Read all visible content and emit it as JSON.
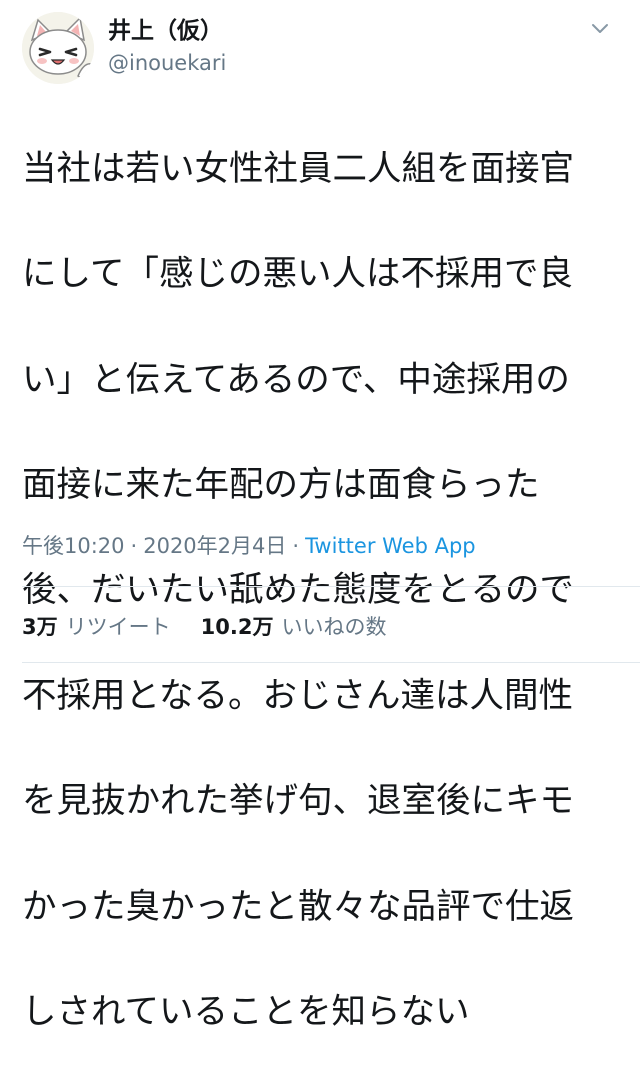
{
  "user": {
    "display_name": "井上（仮）",
    "handle": "@inouekari",
    "avatar_icon": "cat-avatar-icon"
  },
  "menu": {
    "icon": "chevron-down-icon"
  },
  "tweet": {
    "text_lines": [
      "当社は若い女性社員二人組を面接官",
      "にして「感じの悪い人は不採用で良",
      "い」と伝えてあるので、中途採用の",
      "面接に来た年配の方は面食らった",
      "後、だいたい舐めた態度をとるので",
      "不採用となる。おじさん達は人間性",
      "を見抜かれた挙げ句、退室後にキモ",
      "かった臭かったと散々な品評で仕返",
      "しされていることを知らない"
    ]
  },
  "meta": {
    "time": "午後10:20",
    "separator": "·",
    "date": "2020年2月4日",
    "source": "Twitter Web App"
  },
  "stats": {
    "retweets_count": "3万",
    "retweets_label": "リツイート",
    "likes_count": "10.2万",
    "likes_label": "いいねの数"
  },
  "colors": {
    "text": "#14171a",
    "muted": "#657786",
    "link": "#1b95e0",
    "divider": "#e1e8ed"
  }
}
